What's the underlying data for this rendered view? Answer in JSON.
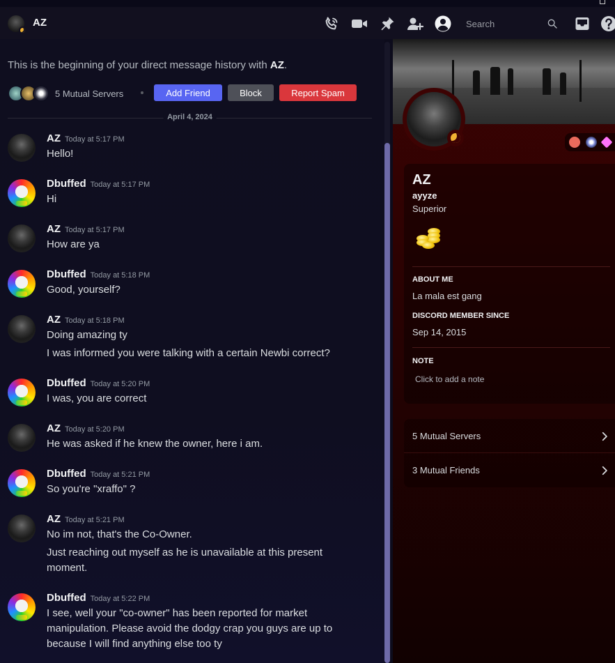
{
  "header": {
    "title": "AZ",
    "search_placeholder": "Search",
    "icons": [
      "call-icon",
      "video-icon",
      "pin-icon",
      "add-friend-icon",
      "user-profile-icon",
      "search-icon",
      "inbox-icon",
      "help-icon"
    ]
  },
  "intro": {
    "text_prefix": "This is the beginning of your direct message history with ",
    "name": "AZ",
    "text_suffix": ".",
    "mutual_servers": "5 Mutual Servers",
    "buttons": {
      "add_friend": "Add Friend",
      "block": "Block",
      "report_spam": "Report Spam"
    }
  },
  "date_divider": "April 4, 2024",
  "messages": [
    {
      "author": "AZ",
      "time": "Today at 5:17 PM",
      "lines": [
        "Hello!"
      ]
    },
    {
      "author": "Dbuffed",
      "time": "Today at 5:17 PM",
      "lines": [
        "Hi"
      ]
    },
    {
      "author": "AZ",
      "time": "Today at 5:17 PM",
      "lines": [
        "How are ya"
      ]
    },
    {
      "author": "Dbuffed",
      "time": "Today at 5:18 PM",
      "lines": [
        "Good, yourself?"
      ]
    },
    {
      "author": "AZ",
      "time": "Today at 5:18 PM",
      "lines": [
        "Doing amazing ty",
        "I was informed you were talking with a certain Newbi correct?"
      ]
    },
    {
      "author": "Dbuffed",
      "time": "Today at 5:20 PM",
      "lines": [
        "I was, you are correct"
      ]
    },
    {
      "author": "AZ",
      "time": "Today at 5:20 PM",
      "lines": [
        "He was asked if he knew the owner, here i am."
      ]
    },
    {
      "author": "Dbuffed",
      "time": "Today at 5:21 PM",
      "lines": [
        "So you're \"xraffo\" ?"
      ]
    },
    {
      "author": "AZ",
      "time": "Today at 5:21 PM",
      "lines": [
        "No im not, that's the Co-Owner.",
        "Just reaching out myself as he is unavailable at this present moment."
      ]
    },
    {
      "author": "Dbuffed",
      "time": "Today at 5:22 PM",
      "lines": [
        "I see, well your \"co-owner\" has been reported for market manipulation. Please avoid the dodgy crap you guys are up to because I will find anything else too ty"
      ]
    }
  ],
  "profile": {
    "display_name": "AZ",
    "username": "ayyze",
    "pronouns": "Superior",
    "about_me_heading": "ABOUT ME",
    "about_me": "La mala est gang",
    "member_since_heading": "DISCORD MEMBER SINCE",
    "member_since": "Sep 14, 2015",
    "note_heading": "NOTE",
    "note_placeholder": "Click to add a note",
    "mutual_servers": "5 Mutual Servers",
    "mutual_friends": "3 Mutual Friends",
    "status": "idle",
    "accent_color": "#3d0303"
  }
}
